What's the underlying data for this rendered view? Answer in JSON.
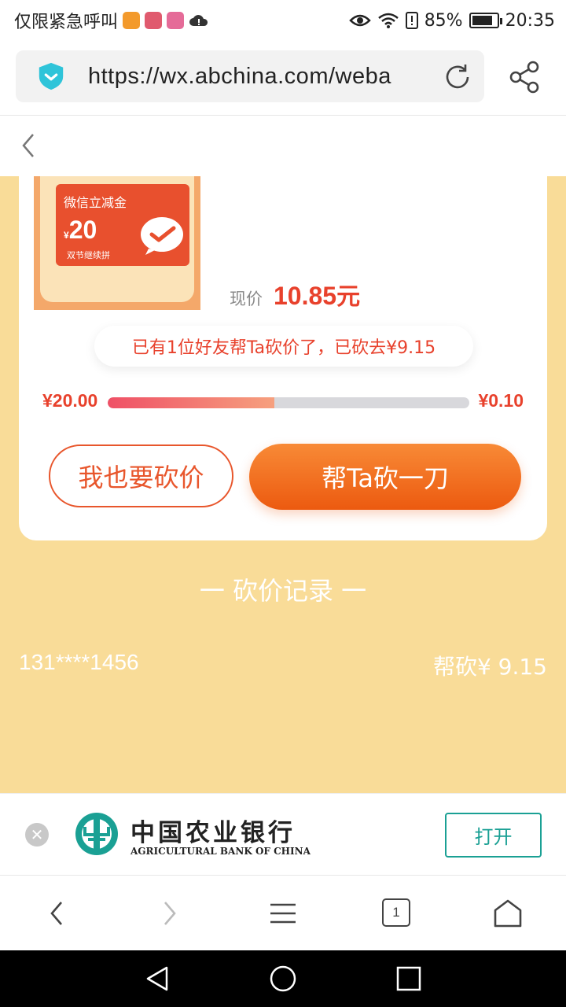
{
  "status_bar": {
    "carrier_text": "仅限紧急呼叫",
    "battery_text": "85%",
    "battery_level": 0.85,
    "time": "20:35",
    "icons": [
      "uc-browser-icon",
      "app-pin-icon",
      "app-pink-icon",
      "cloud-icon",
      "eye-icon",
      "wifi-icon",
      "alert-icon",
      "battery-icon"
    ]
  },
  "browser": {
    "url": "https://wx.abchina.com/weba",
    "icons": [
      "shield-icon",
      "reload-icon",
      "share-icon"
    ]
  },
  "page_header": {
    "back_icon": "chevron-left-icon"
  },
  "product": {
    "coupon_title": "微信立减金",
    "coupon_currency": "¥",
    "coupon_amount": "20",
    "coupon_sub": "双节继续拼",
    "price_label": "现价",
    "price_value": "10.85",
    "price_unit": "元"
  },
  "bargain": {
    "info_text": "已有1位好友帮Ta砍价了，已砍去¥9.15",
    "start_price": "¥20.00",
    "end_price": "¥0.10",
    "progress": 0.46,
    "self_button": "我也要砍价",
    "help_button": "帮Ta砍一刀"
  },
  "records": {
    "title": "一 砍价记录 一",
    "items": [
      {
        "user": "131****1456",
        "amount": "帮砍¥ 9.15"
      }
    ]
  },
  "banner": {
    "bank_name": "中国农业银行",
    "bank_name_en": "AGRICULTURAL BANK OF CHINA",
    "open_button": "打开",
    "brand_color": "#1aa094"
  },
  "toolbar": {
    "tab_count": "1",
    "icons": [
      "back-icon",
      "forward-icon",
      "menu-icon",
      "tabs-icon",
      "home-icon"
    ]
  },
  "colors": {
    "accent": "#e8412c",
    "page_background": "#f9dc98",
    "button_orange": "#ec5a10"
  }
}
